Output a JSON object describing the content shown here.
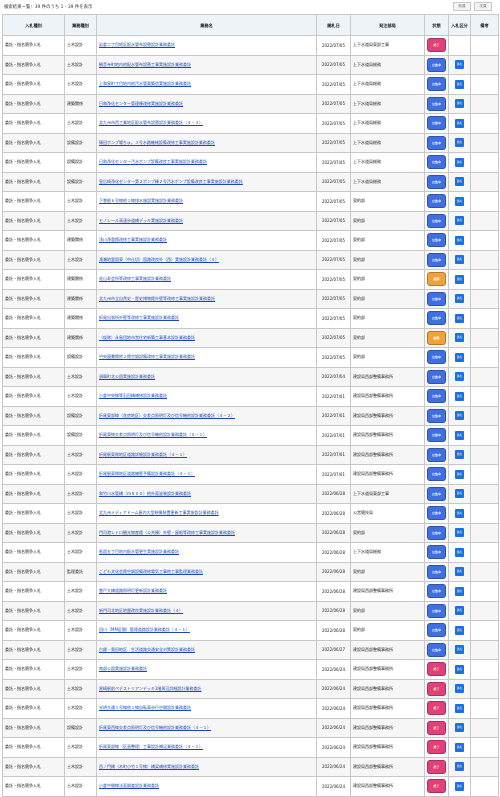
{
  "header": {
    "summary": "検索結果一覧：39 件のうち 1 - 39 件を表示",
    "prev_button": "前頁",
    "next_button": "次頁"
  },
  "columns": [
    "入札種別",
    "業務種別",
    "業務名",
    "開札日",
    "発注部局",
    "状態",
    "入札区分",
    "備考"
  ],
  "colors": {
    "link": "#1a46b8",
    "status_ended": "#e0407c",
    "status_open": "#3f6fe0",
    "status_finished": "#f0a23a",
    "result_button": "#1e6fdc"
  },
  "rows": [
    {
      "type": "委託・指名競争入札",
      "category": "土木設計",
      "name": "岩倉二丁目地区配水管布設替設計業務委託",
      "date": "2022/07/05",
      "dept": "上下水道局東部工事",
      "status": "ended",
      "status_label": "終了",
      "result": "",
      "note": ""
    },
    {
      "type": "委託・指名競争入札",
      "category": "土木設計",
      "name": "観音寺町地内他配水管布設替工事実施設計業務委託",
      "date": "2022/07/05",
      "dept": "上下水道局総務",
      "status": "open",
      "status_label": "公告中",
      "result": "落札",
      "note": ""
    },
    {
      "type": "委託・指名競争入札",
      "category": "土木設計",
      "name": "上和泉町丁目地内他汚水管渠築造実施設計業務委託",
      "date": "2022/07/05",
      "dept": "上下水道局総務",
      "status": "open",
      "status_label": "公告中",
      "result": "落札",
      "note": ""
    },
    {
      "type": "委託・指名競争入札",
      "category": "建築関係",
      "name": "日和浄化センター管理棟改修実施設計業務委託",
      "date": "2022/07/05",
      "dept": "上下水道局総務",
      "status": "open",
      "status_label": "公告中",
      "result": "落札",
      "note": ""
    },
    {
      "type": "委託・指名競争入札",
      "category": "土木設計",
      "name": "北九州市西工業地区配水管布設替設計業務委託（４－３）",
      "date": "2022/07/05",
      "dept": "上下水道局総務",
      "status": "open",
      "status_label": "公告中",
      "result": "落札",
      "note": ""
    },
    {
      "type": "委託・指名競争入札",
      "category": "設備設計",
      "name": "篠田ポンプ場ちゅ。３号水路機械設備改修工事実施設計業務委託",
      "date": "2022/07/05",
      "dept": "上下水道局総務",
      "status": "open",
      "status_label": "公告中",
      "result": "落札",
      "note": ""
    },
    {
      "type": "委託・指名競争入札",
      "category": "設備設計",
      "name": "日和浄化センター汚水ポンプ設備改良工事実施設計業務委託",
      "date": "2022/07/05",
      "dept": "上下水道局総務",
      "status": "open",
      "status_label": "公告中",
      "result": "落札",
      "note": ""
    },
    {
      "type": "委託・指名競争入札",
      "category": "設備設計",
      "name": "皇后崎浄化センター第２ポンプ棟２号汚水ポンプ設備改良工事実施設計業務委託",
      "date": "2022/07/05",
      "dept": "上下水道局総務",
      "status": "open",
      "status_label": "公告中",
      "result": "落札",
      "note": ""
    },
    {
      "type": "委託・指名競争入札",
      "category": "土木設計",
      "name": "下曽根６号線他１線排水施設実施設計業務委託",
      "date": "2022/07/05",
      "dept": "契約部",
      "status": "open",
      "status_label": "公告中",
      "result": "落札",
      "note": ""
    },
    {
      "type": "委託・指名競争入札",
      "category": "土木設計",
      "name": "モノレール高速歩道橋デッキ実施設計業務委託",
      "date": "2022/07/05",
      "dept": "契約部",
      "status": "open",
      "status_label": "公告中",
      "result": "落札",
      "note": ""
    },
    {
      "type": "委託・指名競争入札",
      "category": "建築関係",
      "name": "浅川浄霊館改修工事実施設計業務委託",
      "date": "2022/07/05",
      "dept": "契約部",
      "status": "open",
      "status_label": "公告中",
      "result": "落札",
      "note": ""
    },
    {
      "type": "委託・指名競争入札",
      "category": "土木設計",
      "name": "滝瀬地霊園東（中仕切）園路改良外（西）実施設計業務委託（４）",
      "date": "2022/07/05",
      "dept": "契約部",
      "status": "open",
      "status_label": "公告中",
      "result": "落札",
      "note": ""
    },
    {
      "type": "委託・指名競争入札",
      "category": "建築関係",
      "name": "花山寿会所等改修工事実施設計業務委託",
      "date": "2022/07/05",
      "dept": "契約部",
      "status": "fin",
      "status_label": "結果",
      "result": "落札",
      "note": ""
    },
    {
      "type": "委託・指名競争入札",
      "category": "建築関係",
      "name": "北九州市立自然史・歴史博物館外壁等改修工事実施設計業務委託",
      "date": "2022/07/05",
      "dept": "契約部",
      "status": "open",
      "status_label": "公告中",
      "result": "落札",
      "note": ""
    },
    {
      "type": "委託・指名競争入札",
      "category": "建築関係",
      "name": "折尾出張所外壁等改修工事実施設計業務委託",
      "date": "2022/07/05",
      "dept": "契約部",
      "status": "open",
      "status_label": "公告中",
      "result": "落札",
      "note": ""
    },
    {
      "type": "委託・指名競争入札",
      "category": "建築関係",
      "name": "（仮称）永島団地市営住宅新築工事基本設計業務委託",
      "date": "2022/07/05",
      "dept": "契約部",
      "status": "fin",
      "status_label": "結果",
      "result": "落札",
      "note": ""
    },
    {
      "type": "委託・指名競争入札",
      "category": "設備設計",
      "name": "中央図書館他２館空調設備改修工事実施設計業務委託",
      "date": "2022/07/05",
      "dept": "契約部",
      "status": "open",
      "status_label": "公告中",
      "result": "落札",
      "note": ""
    },
    {
      "type": "委託・指名競争入札",
      "category": "土木設計",
      "name": "須摩町北公園実施設計業務委託",
      "date": "2022/07/04",
      "dept": "建設局西部整備事務所",
      "status": "open",
      "status_label": "公告中",
      "result": "落札",
      "note": ""
    },
    {
      "type": "委託・指名競争入札",
      "category": "土木設計",
      "name": "小倉中央線等石田橋補修設計業務委託",
      "date": "2022/07/01",
      "dept": "建設局西部整備事務所",
      "status": "open",
      "status_label": "公告中",
      "result": "落札",
      "note": ""
    },
    {
      "type": "委託・指名競争入札",
      "category": "設備設計",
      "name": "折尾東部線（花房地区）交差点照明灯及び信号機他設計業務委託（４－２）",
      "date": "2022/07/01",
      "dept": "建設局西部整備事務所",
      "status": "open",
      "status_label": "公告中",
      "result": "落札",
      "note": ""
    },
    {
      "type": "委託・指名競争入札",
      "category": "設備設計",
      "name": "折尾東線交差点照明灯及び信号機他設計業務委託（４－１）",
      "date": "2022/07/01",
      "dept": "建設局西部整備事務所",
      "status": "open",
      "status_label": "公告中",
      "result": "落札",
      "note": ""
    },
    {
      "type": "委託・指名競争入札",
      "category": "土木設計",
      "name": "折尾駅東側地区道路詳細設計業務委託（４－１）",
      "date": "2022/07/01",
      "dept": "建設局西部整備事務所",
      "status": "open",
      "status_label": "公告中",
      "result": "落札",
      "note": ""
    },
    {
      "type": "委託・指名競争入札",
      "category": "土木設計",
      "name": "折尾駅東側地区道路擁壁予備設計業務委託（４－１）",
      "date": "2022/07/01",
      "dept": "建設局西部整備事務所",
      "status": "open",
      "status_label": "公告中",
      "result": "落札",
      "note": ""
    },
    {
      "type": "委託・指名競争入札",
      "category": "土木設計",
      "name": "和竹川水管橋（ｍ５００）他外面塗装設計業務委託",
      "date": "2022/06/28",
      "dept": "上下水道局東部工事",
      "status": "open",
      "status_label": "公告中",
      "result": "落札",
      "note": ""
    },
    {
      "type": "委託・指名競争入札",
      "category": "土木設計",
      "name": "北九州メディアドーム屋内大型映像装置更新工事実施設計業務委託",
      "date": "2022/06/28",
      "dept": "公営競技局",
      "status": "open",
      "status_label": "公告中",
      "result": "落札",
      "note": ""
    },
    {
      "type": "委託・指名競争入札",
      "category": "土木設計",
      "name": "門司港レトロ観光物産館（公共棟）外壁・屋根等改修工事実施設計業務委託",
      "date": "2022/06/28",
      "dept": "契約部",
      "status": "open",
      "status_label": "公告中",
      "result": "落札",
      "note": ""
    },
    {
      "type": "委託・指名競争入札",
      "category": "土木設計",
      "name": "祇園五丁目地内配水管更生実施設計業務委託",
      "date": "2022/06/28",
      "dept": "上下水道局総務",
      "status": "open",
      "status_label": "公告中",
      "result": "落札",
      "note": ""
    },
    {
      "type": "委託・指名競争入札",
      "category": "監理委託",
      "name": "こども文化会館空調設備改修電気工事他工事監理業務委託",
      "date": "2022/06/28",
      "dept": "契約部",
      "status": "open",
      "status_label": "公告中",
      "result": "落札",
      "note": ""
    },
    {
      "type": "委託・指名競争入札",
      "category": "土木設計",
      "name": "曽戸大橋道路照明灯更新設計業務委託",
      "date": "2022/06/28",
      "dept": "建設局西部整備事務所",
      "status": "open",
      "status_label": "公告中",
      "result": "落札",
      "note": ""
    },
    {
      "type": "委託・指名競争入札",
      "category": "土木設計",
      "name": "新門司北地区地盤改良実施設計業務委託（４）",
      "date": "2022/06/28",
      "dept": "契約部",
      "status": "open",
      "status_label": "公告中",
      "result": "落札",
      "note": ""
    },
    {
      "type": "委託・指名競争入札",
      "category": "土木設計",
      "name": "田川（MM区間）管理道路設計業務委託（４－１）",
      "date": "2022/06/28",
      "dept": "契約部",
      "status": "open",
      "status_label": "公告中",
      "result": "落札",
      "note": ""
    },
    {
      "type": "委託・指名競争入札",
      "category": "土木設計",
      "name": "白銀・奥田地区　生活道路交通安全対策設計業務委託",
      "date": "2022/06/27",
      "dept": "建設局西部整備事務所",
      "status": "open",
      "status_label": "公告中",
      "result": "落札",
      "note": ""
    },
    {
      "type": "委託・指名競争入札",
      "category": "土木設計",
      "name": "南部公園実施設計業務委託",
      "date": "2022/06/24",
      "dept": "建設局西部整備事務所",
      "status": "ended",
      "status_label": "終了",
      "result": "落札",
      "note": ""
    },
    {
      "type": "委託・指名競争入札",
      "category": "土木設計",
      "name": "黒崎駅前ペデストリアンデッキ1階周辺詳細設計業務委託",
      "date": "2022/06/24",
      "dept": "建設局西部整備事務所",
      "status": "ended",
      "status_label": "終了",
      "result": "落札",
      "note": ""
    },
    {
      "type": "委託・指名競争入札",
      "category": "土木設計",
      "name": "光明大通１号線他１線自転車歩行空間設計業務委託",
      "date": "2022/06/24",
      "dept": "建設局西部整備事務所",
      "status": "ended",
      "status_label": "終了",
      "result": "落札",
      "note": ""
    },
    {
      "type": "委託・指名競争入札",
      "category": "設備設計",
      "name": "折尾東西線交差点照明灯及び信号機他設計業務委託（４－１）",
      "date": "2022/06/24",
      "dept": "建設局西部整備事務所",
      "status": "ended",
      "status_label": "終了",
      "result": "落札",
      "note": ""
    },
    {
      "type": "委託・指名競争入札",
      "category": "土木設計",
      "name": "折尾東部線（区画整理）工事設計補足業務委託（４－１）",
      "date": "2022/06/24",
      "dept": "建設局西部整備事務所",
      "status": "ended",
      "status_label": "終了",
      "result": "落札",
      "note": ""
    },
    {
      "type": "委託・指名競争入札",
      "category": "土木設計",
      "name": "西ノ門橋（木町小竹１号線）橋梁補修実施設計業務委託",
      "date": "2022/06/24",
      "dept": "建設局西部整備事務所",
      "status": "ended",
      "status_label": "終了",
      "result": "落札",
      "note": ""
    },
    {
      "type": "委託・指名競争入札",
      "category": "土木設計",
      "name": "小倉中間線法面調査設計業務委託",
      "date": "2022/06/24",
      "dept": "建設局西部整備事務所",
      "status": "ended",
      "status_label": "終了",
      "result": "落札",
      "note": ""
    }
  ]
}
